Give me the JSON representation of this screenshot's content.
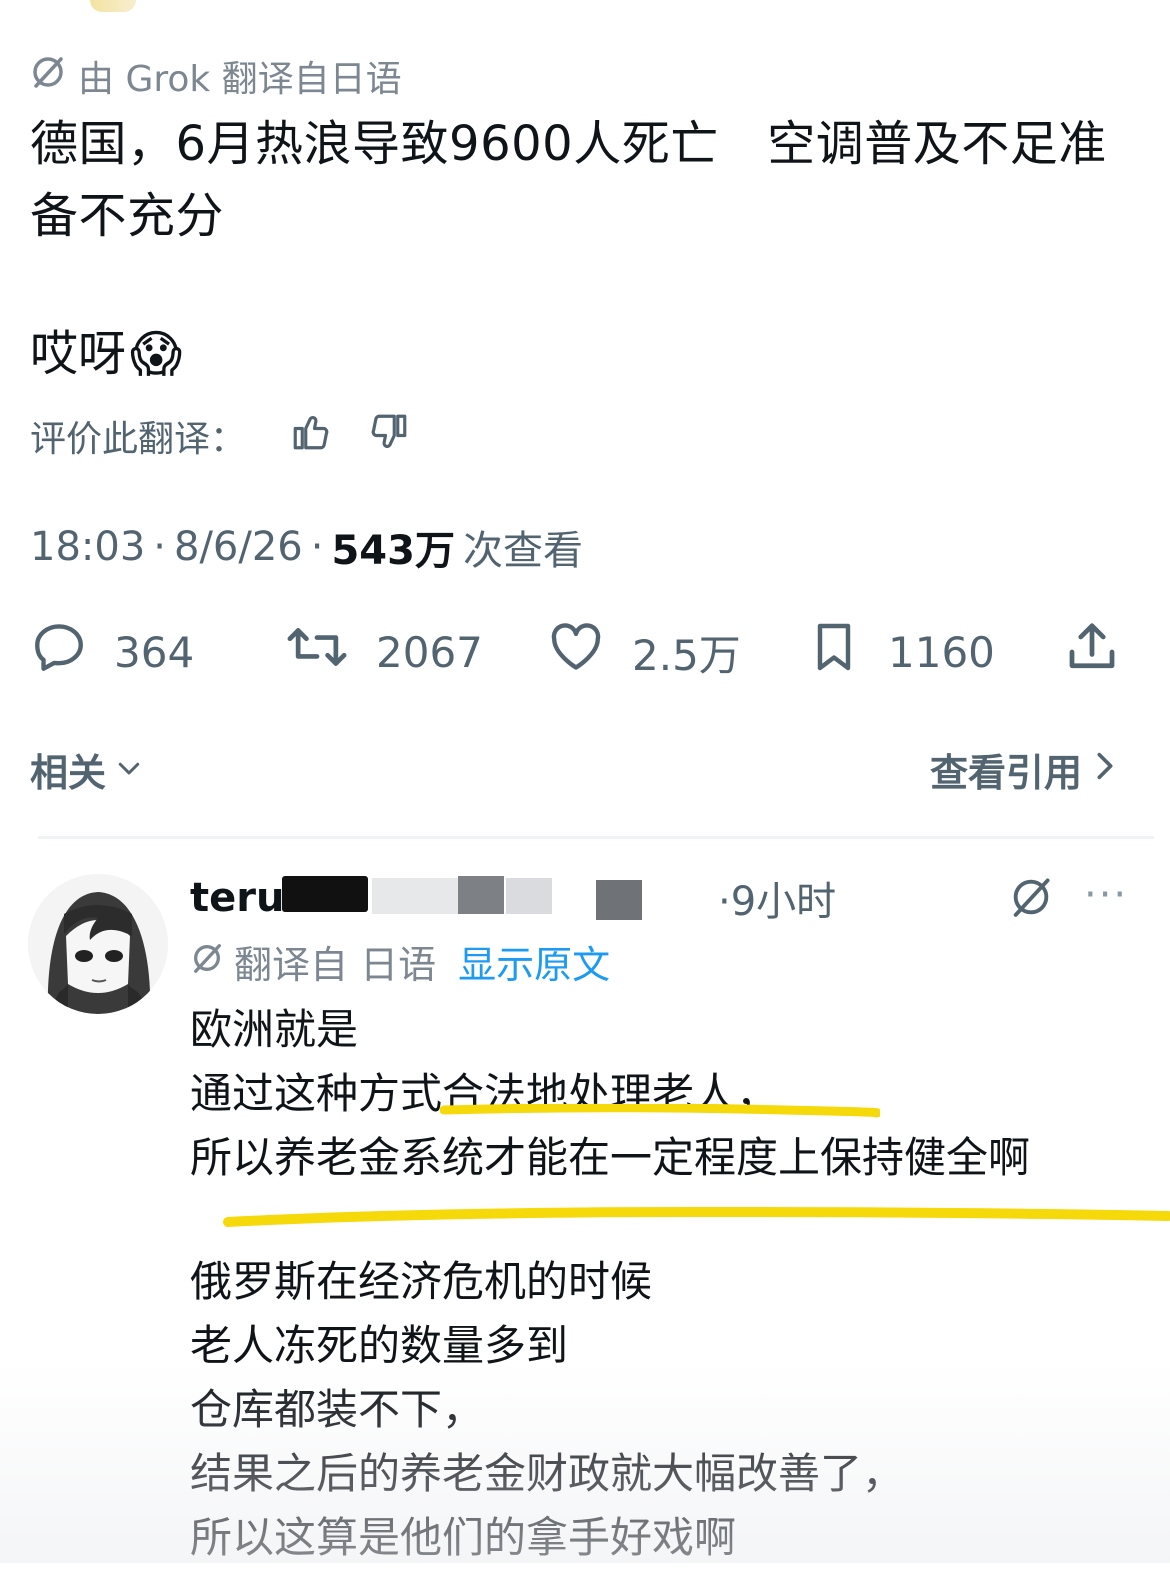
{
  "post": {
    "translation_note": "由 Grok 翻译自日语",
    "headline": "德国，6月热浪导致9600人死亡　空调普及不足准备不充分",
    "exclamation": "哎呀",
    "exclamation_emoji": "😱",
    "rate_label": "评价此翻译：",
    "time": "18:03",
    "date": "8/6/26",
    "views_count": "543万",
    "views_label": "次查看",
    "sep": "·"
  },
  "actions": {
    "replies": "364",
    "reposts": "2067",
    "likes": "2.5万",
    "bookmarks": "1160"
  },
  "related": {
    "label": "相关",
    "quotes_label": "查看引用"
  },
  "reply": {
    "username_visible": "teru",
    "time": "·9小时",
    "more": "···",
    "translated_from": "翻译自 日语",
    "show_original": "显示原文",
    "lines": [
      "欧洲就是",
      "通过这种方式合法地处理老人，",
      "所以养老金系统才能在一定程度上保持健全啊",
      "俄罗斯在经济危机的时候",
      "老人冻死的数量多到",
      "仓库都装不下，",
      "结果之后的养老金财政就大幅改善了，",
      "所以这算是他们的拿手好戏啊"
    ]
  },
  "colors": {
    "accent": "#1d9bf0",
    "highlight": "#f5d90a",
    "muted": "#536471"
  }
}
